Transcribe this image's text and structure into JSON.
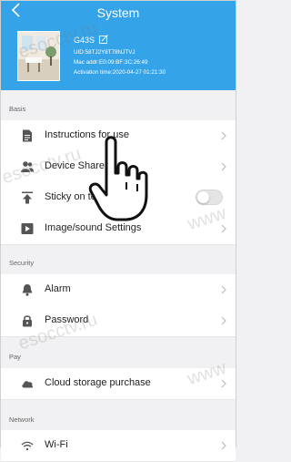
{
  "header": {
    "title": "System",
    "device": {
      "name": "G43S",
      "uid_label": "UID:58TJ2Y8T78NJTVJ",
      "mac_label": "Mac addr:E0:09:BF:3C:26:49",
      "activation_label": "Activation time:2020-04-27 01:21:30"
    }
  },
  "sections": {
    "basis": {
      "label": "Basis",
      "items": [
        {
          "label": "Instructions for use",
          "icon": "document-icon"
        },
        {
          "label": "Device Share",
          "icon": "users-icon"
        },
        {
          "label": "Sticky on top",
          "icon": "arrow-up-icon",
          "toggle": false
        },
        {
          "label": "Image/sound Settings",
          "icon": "play-icon"
        }
      ]
    },
    "security": {
      "label": "Security",
      "items": [
        {
          "label": "Alarm",
          "icon": "bell-icon"
        },
        {
          "label": "Password",
          "icon": "lock-icon"
        }
      ]
    },
    "pay": {
      "label": "Pay",
      "items": [
        {
          "label": "Cloud storage purchase",
          "icon": "cloud-icon"
        }
      ]
    },
    "network": {
      "label": "Network",
      "items": [
        {
          "label": "Wi-Fi",
          "icon": "wifi-icon"
        }
      ]
    }
  },
  "watermarks": [
    "esocctv.ru",
    "esocctv.ru",
    "www",
    "esocctv.ru",
    "www"
  ],
  "colors": {
    "header": "#35a3e8",
    "background": "#f1f1f3",
    "icon": "#555555"
  }
}
